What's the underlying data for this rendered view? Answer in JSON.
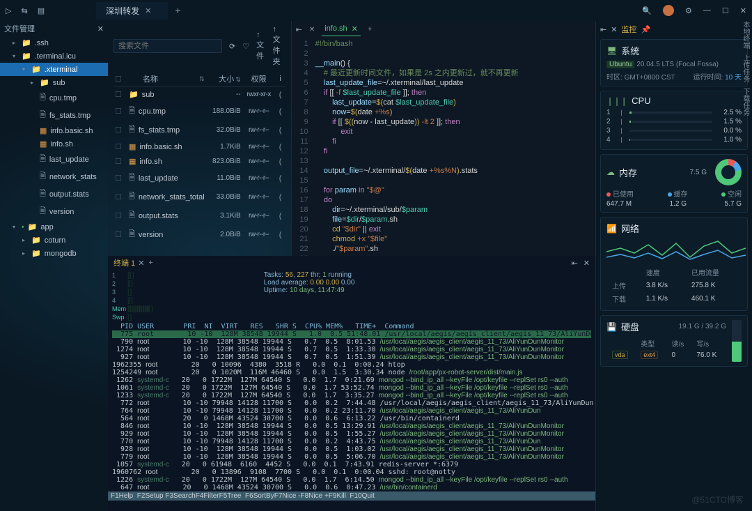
{
  "titlebar": {
    "tab": "深圳转发"
  },
  "sidebar": {
    "title": "文件管理",
    "items": [
      {
        "d": 1,
        "t": "folder",
        "n": ".ssh",
        "c": "▸"
      },
      {
        "d": 1,
        "t": "folder",
        "n": ".terminal.icu",
        "c": "▾"
      },
      {
        "d": 2,
        "t": "folder",
        "n": ".xterminal",
        "c": "▾",
        "sel": true
      },
      {
        "d": 3,
        "t": "folder",
        "n": "sub",
        "c": "▸",
        "cls": "sub"
      },
      {
        "d": 3,
        "t": "file",
        "n": "cpu.tmp"
      },
      {
        "d": 3,
        "t": "file",
        "n": "fs_stats.tmp"
      },
      {
        "d": 3,
        "t": "yml",
        "n": "info.basic.sh"
      },
      {
        "d": 3,
        "t": "yml",
        "n": "info.sh"
      },
      {
        "d": 3,
        "t": "file",
        "n": "last_update"
      },
      {
        "d": 3,
        "t": "file",
        "n": "network_stats"
      },
      {
        "d": 3,
        "t": "file",
        "n": "output.stats"
      },
      {
        "d": 3,
        "t": "file",
        "n": "version"
      },
      {
        "d": 1,
        "t": "folder",
        "n": "app",
        "c": "▾",
        "cls": "sub",
        "dot": true
      },
      {
        "d": 2,
        "t": "folder",
        "n": "coturn",
        "c": "▸",
        "cls": "blue"
      },
      {
        "d": 2,
        "t": "folder",
        "n": "mongodb",
        "c": "▸",
        "cls": "blue"
      }
    ]
  },
  "fb": {
    "search_ph": "搜索文件",
    "btn_file": "文件",
    "btn_folder": "文件夹",
    "cols": {
      "name": "名称",
      "size": "大小",
      "perm": "权限",
      "info": "i"
    },
    "rows": [
      {
        "ico": "folder",
        "n": "sub",
        "sz": "--",
        "pm": "rwxr-xr-x"
      },
      {
        "ico": "file",
        "n": "cpu.tmp",
        "sz": "188.0BiB",
        "pm": "rw-r--r--"
      },
      {
        "ico": "file",
        "n": "fs_stats.tmp",
        "sz": "32.0BiB",
        "pm": "rw-r--r--"
      },
      {
        "ico": "yml",
        "n": "info.basic.sh",
        "sz": "1.7KiB",
        "pm": "rw-r--r--"
      },
      {
        "ico": "yml",
        "n": "info.sh",
        "sz": "823.0BiB",
        "pm": "rw-r--r--"
      },
      {
        "ico": "file",
        "n": "last_update",
        "sz": "11.0BiB",
        "pm": "rw-r--r--"
      },
      {
        "ico": "file",
        "n": "network_stats_total",
        "sz": "33.0BiB",
        "pm": "rw-r--r--"
      },
      {
        "ico": "file",
        "n": "output.stats",
        "sz": "3.1KiB",
        "pm": "rw-r--r--"
      },
      {
        "ico": "file",
        "n": "version",
        "sz": "2.0BiB",
        "pm": "rw-r--r--"
      }
    ]
  },
  "editor": {
    "tab": "info.sh",
    "lines": [
      "<span class='tok-c'>#!/bin/bash</span>",
      "",
      "<span class='tok-b'>__main</span><span class='tok-w'>()</span> <span class='tok-w'>{</span>",
      "    <span class='tok-c'># 最近更新时间文件，如果是 2s 之内更新过，就不再更新</span>",
      "    <span class='tok-b'>last_update_file</span><span class='tok-w'>=~/.xterminal/last_update</span>",
      "    <span class='tok-k'>if</span> <span class='tok-w'>[[</span> <span class='tok-s'>-f</span> <span class='tok-v'>$last_update_file</span> <span class='tok-w'>]];</span> <span class='tok-k'>then</span>",
      "        <span class='tok-b'>last_update</span><span class='tok-w'>=</span><span class='tok-y'>$(</span><span class='tok-w'>cat </span><span class='tok-v'>$last_update_file</span><span class='tok-y'>)</span>",
      "        <span class='tok-b'>now</span><span class='tok-w'>=</span><span class='tok-y'>$(</span><span class='tok-w'>date </span><span class='tok-s'>+%s</span><span class='tok-y'>)</span>",
      "        <span class='tok-k'>if</span> <span class='tok-w'>[[</span> <span class='tok-y'>$((</span><span class='tok-w'>now - last_update</span><span class='tok-y'>))</span> <span class='tok-s'>-lt 2</span> <span class='tok-w'>]];</span> <span class='tok-k'>then</span>",
      "            <span class='tok-k'>exit</span>",
      "        <span class='tok-k'>fi</span>",
      "    <span class='tok-k'>fi</span>",
      "",
      "    <span class='tok-b'>output_file</span><span class='tok-w'>=~/.xterminal/</span><span class='tok-y'>$(</span><span class='tok-w'>date </span><span class='tok-s'>+%s%N</span><span class='tok-y'>)</span><span class='tok-w'>.stats</span>",
      "",
      "    <span class='tok-k'>for</span> <span class='tok-b'>param</span> <span class='tok-k'>in</span> <span class='tok-s'>\"$@\"</span>",
      "    <span class='tok-k'>do</span>",
      "        <span class='tok-b'>dir</span><span class='tok-w'>=~/.xterminal/sub/</span><span class='tok-v'>$param</span>",
      "        <span class='tok-b'>file</span><span class='tok-w'>=</span><span class='tok-v'>$dir</span><span class='tok-w'>/</span><span class='tok-v'>$param</span><span class='tok-w'>.sh</span>",
      "        <span class='tok-y'>cd</span> <span class='tok-s'>\"$dir\"</span> <span class='tok-w'>||</span> <span class='tok-k'>exit</span>",
      "        <span class='tok-y'>chmod</span> <span class='tok-s'>+x</span> <span class='tok-s'>\"$file\"</span>",
      "        <span class='tok-w'>./</span><span class='tok-s'>\"$param\"</span><span class='tok-w'>.sh</span>"
    ]
  },
  "term": {
    "title": "终端 1",
    "stats": {
      "tasks": "Tasks: <span class='hl'>56</span>, <span class='hl'>227</span> thr; <span class='gr'>1</span> running",
      "load": "Load average: <span class='hl'>0.00 0.00</span> 0.00",
      "uptime": "Uptime: <span class='gr'>10 days, 11:47:49</span>"
    },
    "head": "  PID USER       PRI  NI  VIRT   RES   SHR S  CPU% MEM%   TIME+  Command",
    "rows": [
      {
        "hi": true,
        "t": "  775 root        10 -10  128M 38548 19944 S   1.0  0.5 51:48.01 /usr/local/aegis/aegis_client/aegis_11_73/AliYunDunMonitor"
      },
      {
        "t": "  790 <span class='w'>root</span>        10 -10  128M 38548 19944 S   0.7  0.5  8:01.53 <span class='g'>/usr/local/aegis/aegis_client/aegis_11_73/AliYunDunMonitor</span>"
      },
      {
        "t": " 1274 <span class='w'>root</span>        10 -10  128M 38548 19944 S   0.7  0.5  1:33.30 <span class='g'>/usr/local/aegis/aegis_client/aegis_11_73/AliYunDunMonitor</span>"
      },
      {
        "t": "  927 <span class='w'>root</span>        10 -10  128M 38548 19944 S   0.7  0.5  1:51.39 <span class='g'>/usr/local/aegis/aegis_client/aegis_11_73/AliYunDunMonitor</span>"
      },
      {
        "t": "1962355 <span class='w'>root</span>        20   0 10096  4380  3518 R   0.0  0.1  0:00.24 htop"
      },
      {
        "t": "1254249 <span class='w'>root</span>        20   0 1020M  116M 46460 S   0.0  1.5  3:30.34 node <span class='g'>/root/app/px-robot-server/dist/main.js</span>"
      },
      {
        "t": " 1262 <span class='c'>systemd-c</span>   20   0 1722M  127M 64540 S   0.0  1.7  0:21.69 <span class='g'>mongod --bind_ip_all --keyFile /opt/keyfile --replSet rs0 --auth</span>"
      },
      {
        "t": " 1061 <span class='c'>systemd-c</span>   20   0 1722M  127M 64540 S   0.0  1.7 53:52.74 <span class='g'>mongod --bind_ip_all --keyFile /opt/keyfile --replSet rs0 --auth</span>"
      },
      {
        "t": " 1233 <span class='c'>systemd-c</span>   20   0 1722M  127M 64540 S   0.0  1.7  3:35.27 <span class='g'>mongod --bind_ip_all --keyFile /opt/keyfile --replSet rs0 --auth</span>"
      },
      {
        "t": "  772 <span class='w'>root</span>        10 -10 79948 14128 11700 S   0.0  0.2  7:44.48 /usr/local/aegis/aegis_client/aegis_11_73/AliYunDun"
      },
      {
        "t": "  764 <span class='w'>root</span>        10 -10 79948 14128 11700 S   0.0  0.2 23:11.70 <span class='g'>/usr/local/aegis/aegis_client/aegis_11_73/AliYunDun</span>"
      },
      {
        "t": "  564 <span class='w'>root</span>        20   0 1468M 43524 30700 S   0.0  0.6  6:13.22 /usr/bin/containerd"
      },
      {
        "t": "  846 <span class='w'>root</span>        10 -10  128M 38548 19944 S   0.0  0.5 13:29.91 <span class='g'>/usr/local/aegis/aegis_client/aegis_11_73/AliYunDunMonitor</span>"
      },
      {
        "t": "  929 <span class='w'>root</span>        10 -10  128M 38548 19944 S   0.0  0.5  1:55.27 <span class='g'>/usr/local/aegis/aegis_client/aegis_11_73/AliYunDunMonitor</span>"
      },
      {
        "t": "  770 <span class='w'>root</span>        10 -10 79948 14128 11700 S   0.0  0.2  4:43.75 <span class='g'>/usr/local/aegis/aegis_client/aegis_11_73/AliYunDun</span>"
      },
      {
        "t": "  928 <span class='w'>root</span>        10 -10  128M 38548 19944 S   0.0  0.5  1:03.02 <span class='g'>/usr/local/aegis/aegis_client/aegis_11_73/AliYunDunMonitor</span>"
      },
      {
        "t": "  779 <span class='w'>root</span>        10 -10  128M 38548 19944 S   0.0  0.5  5:06.70 <span class='g'>/usr/local/aegis/aegis_client/aegis_11_73/AliYunDunMonitor</span>"
      },
      {
        "t": " 1057 <span class='c'>systemd-c</span>   20   0 61948  6160  4452 S   0.0  0.1  7:43.91 redis-server *:6379"
      },
      {
        "t": "1960762 <span class='w'>root</span>        20   0 13896  9108  7700 S   0.0  0.1  0:00.04 sshd: root@notty"
      },
      {
        "t": " 1226 <span class='c'>systemd-c</span>   20   0 1722M  127M 64540 S   0.0  1.7  6:14.50 <span class='g'>mongod --bind_ip_all --keyFile /opt/keyfile --replSet rs0 --auth</span>"
      },
      {
        "t": "  647 <span class='w'>root</span>        20   0 1468M 43524 30700 S   0.0  0.6  0:47.23 <span class='g'>/usr/bin/containerd</span>"
      }
    ],
    "foot": "F1Help  F2Setup F3SearchF4FilterF5Tree  F6SortByF7Nice -F8Nice +F9Kill  F10Quit"
  },
  "monitor": {
    "title": "监控",
    "system": {
      "title": "系统",
      "os": "Ubuntu",
      "ver": "20.04.5 LTS (Focal Fossa)",
      "tz_l": "时区:",
      "tz": "GMT+0800 CST",
      "up_l": "运行时间:",
      "up": "10 天"
    },
    "cpu": {
      "title": "CPU",
      "rows": [
        {
          "n": "1",
          "p": "2.5 %",
          "w": 3
        },
        {
          "n": "2",
          "p": "1.5 %",
          "w": 2
        },
        {
          "n": "3",
          "p": "0.0 %",
          "w": 0
        },
        {
          "n": "4",
          "p": "1.0 %",
          "w": 1
        }
      ]
    },
    "mem": {
      "title": "内存",
      "total": "7.5 G",
      "used_l": "已使用",
      "used": "647.7 M",
      "cache_l": "缓存",
      "cache": "1.2 G",
      "free_l": "空闲",
      "free": "5.7 G"
    },
    "net": {
      "title": "网络",
      "speed_l": "速度",
      "traf_l": "已用流量",
      "up_l": "上传",
      "up_s": "3.8 K/s",
      "up_t": "275.8 K",
      "dn_l": "下载",
      "dn_s": "1.1 K/s",
      "dn_t": "460.1 K"
    },
    "disk": {
      "title": "硬盘",
      "usage": "19.1 G / 39.2 G",
      "type_l": "类型",
      "read_l": "读/s",
      "write_l": "写/s",
      "dev": "vda",
      "fs": "ext4",
      "read": "0",
      "write": "76.0 K",
      "fill": 49
    }
  },
  "rtabs": [
    "本地终端",
    "上传任务",
    "下载任务"
  ],
  "watermark": "@51CTO博客"
}
